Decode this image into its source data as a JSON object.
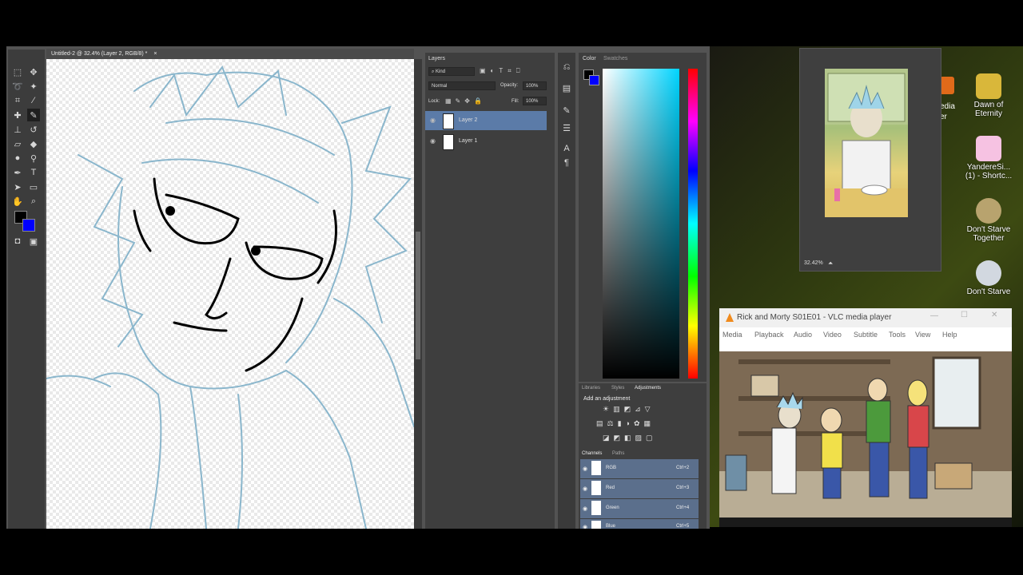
{
  "photoshop": {
    "document_tab": "Untitled-2 @ 32.4% (Layer 2, RGB/8) *",
    "layers_panel": {
      "tab": "Layers",
      "filter": "Kind",
      "blend_mode": "Normal",
      "opacity_label": "Opacity:",
      "opacity_value": "100%",
      "lock_label": "Lock:",
      "fill_label": "Fill:",
      "fill_value": "100%",
      "layers": [
        {
          "name": "Layer 2",
          "selected": true
        },
        {
          "name": "Layer 1",
          "selected": false
        }
      ]
    },
    "color_panel": {
      "tabs": [
        "Color",
        "Swatches"
      ],
      "foreground": "#000000",
      "background": "#0000ff"
    },
    "adjustments_panel": {
      "tabs": [
        "Libraries",
        "Styles",
        "Adjustments"
      ],
      "heading": "Add an adjustment"
    },
    "channels_panel": {
      "tabs": [
        "Channels",
        "Paths"
      ],
      "channels": [
        {
          "name": "RGB",
          "shortcut": "Ctrl+2"
        },
        {
          "name": "Red",
          "shortcut": "Ctrl+3"
        },
        {
          "name": "Green",
          "shortcut": "Ctrl+4"
        },
        {
          "name": "Blue",
          "shortcut": "Ctrl+5"
        }
      ]
    }
  },
  "navigator": {
    "zoom": "32.42%"
  },
  "desktop_icons": [
    {
      "label": "Dawn of Eternity",
      "icon": "game-icon"
    },
    {
      "label": "YandereSi... (1) - Shortc...",
      "icon": "game-icon"
    },
    {
      "label": "Don't Starve Together",
      "icon": "game-icon"
    },
    {
      "label": "Don't Starve",
      "icon": "game-icon"
    }
  ],
  "desktop_partial_text": [
    "edia",
    "er"
  ],
  "vlc": {
    "title": "Rick and Morty S01E01 - VLC media player",
    "menu": [
      "Media",
      "Playback",
      "Audio",
      "Video",
      "Subtitle",
      "Tools",
      "View",
      "Help"
    ]
  }
}
